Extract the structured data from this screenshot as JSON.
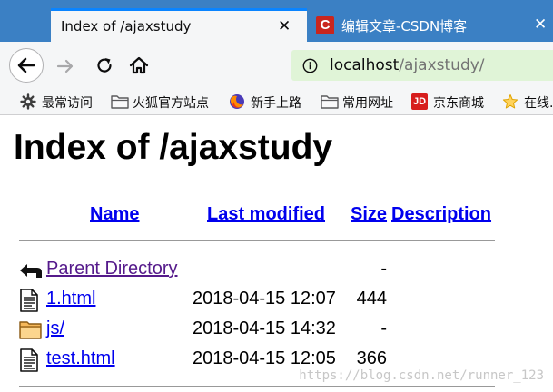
{
  "tabs": [
    {
      "title": "Index of /ajaxstudy",
      "active": true
    },
    {
      "title": "编辑文章-CSDN博客",
      "active": false,
      "icon_text": "C"
    }
  ],
  "nav": {
    "url_host": "localhost",
    "url_path": "/ajaxstudy/"
  },
  "bookmarks": [
    {
      "label": "最常访问",
      "icon": "gear-icon"
    },
    {
      "label": "火狐官方站点",
      "icon": "folder-icon"
    },
    {
      "label": "新手上路",
      "icon": "firefox-icon"
    },
    {
      "label": "常用网址",
      "icon": "folder-icon"
    },
    {
      "label": "京东商城",
      "icon": "jd-icon",
      "icon_text": "JD"
    },
    {
      "label": "在线...",
      "icon": "star-icon"
    }
  ],
  "page": {
    "heading": "Index of /ajaxstudy",
    "columns": {
      "name": "Name",
      "last_modified": "Last modified",
      "size": "Size",
      "description": "Description"
    },
    "rows": [
      {
        "name": "Parent Directory",
        "modified": "",
        "size": "-",
        "icon": "back-arrow-icon"
      },
      {
        "name": "1.html",
        "modified": "2018-04-15 12:07",
        "size": "444",
        "icon": "file-icon"
      },
      {
        "name": "js/",
        "modified": "2018-04-15 14:32",
        "size": "-",
        "icon": "folder-icon"
      },
      {
        "name": "test.html",
        "modified": "2018-04-15 12:05",
        "size": "366",
        "icon": "file-icon"
      }
    ]
  },
  "watermark": "https://blog.csdn.net/runner_123",
  "colors": {
    "tabstrip": "#3b80c4",
    "active_tab_accent": "#0a84ff",
    "url_secure_bg": "#e0f4d7",
    "link": "#0000ee",
    "visited_link": "#551a8b"
  }
}
